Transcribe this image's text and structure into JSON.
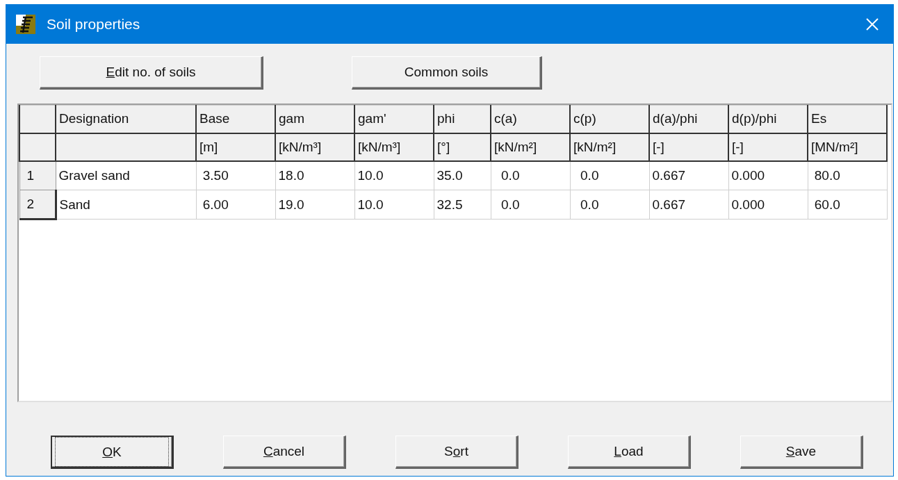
{
  "window": {
    "title": "Soil properties"
  },
  "top_buttons": [
    {
      "access_key": "E",
      "label_rest": "dit no. of soils"
    },
    {
      "label_start": "Common soils"
    }
  ],
  "table": {
    "columns": [
      {
        "name": "Designation"
      },
      {
        "name": "Base",
        "unit": "[m]"
      },
      {
        "name": "gam",
        "unit": "[kN/m³]"
      },
      {
        "name": "gam'",
        "unit": "[kN/m³]"
      },
      {
        "name": "phi",
        "unit": "[°]"
      },
      {
        "name": "c(a)",
        "unit": "[kN/m²]"
      },
      {
        "name": "c(p)",
        "unit": "[kN/m²]"
      },
      {
        "name": "d(a)/phi",
        "unit": "[-]"
      },
      {
        "name": "d(p)/phi",
        "unit": "[-]"
      },
      {
        "name": "Es",
        "unit": "[MN/m²]"
      }
    ],
    "rows": [
      {
        "index": "1",
        "selected": false,
        "cells": [
          "Gravel sand",
          " 3.50",
          "18.0",
          "10.0",
          "35.0",
          "  0.0",
          "  0.0",
          "0.667",
          "0.000",
          " 80.0"
        ]
      },
      {
        "index": "2",
        "selected": true,
        "cells": [
          "Sand",
          " 6.00",
          "19.0",
          "10.0",
          "32.5",
          "  0.0",
          "  0.0",
          "0.667",
          "0.000",
          " 60.0"
        ]
      }
    ]
  },
  "bottom_buttons": [
    {
      "access_key": "O",
      "label_rest": "K",
      "default": true
    },
    {
      "access_key": "C",
      "label_rest": "ancel",
      "default": false
    },
    {
      "label_start": "S",
      "access_key": "o",
      "label_rest": "rt",
      "default": false
    },
    {
      "access_key": "L",
      "label_rest": "oad",
      "default": false
    },
    {
      "access_key": "S",
      "label_rest": "ave",
      "default": false
    }
  ]
}
